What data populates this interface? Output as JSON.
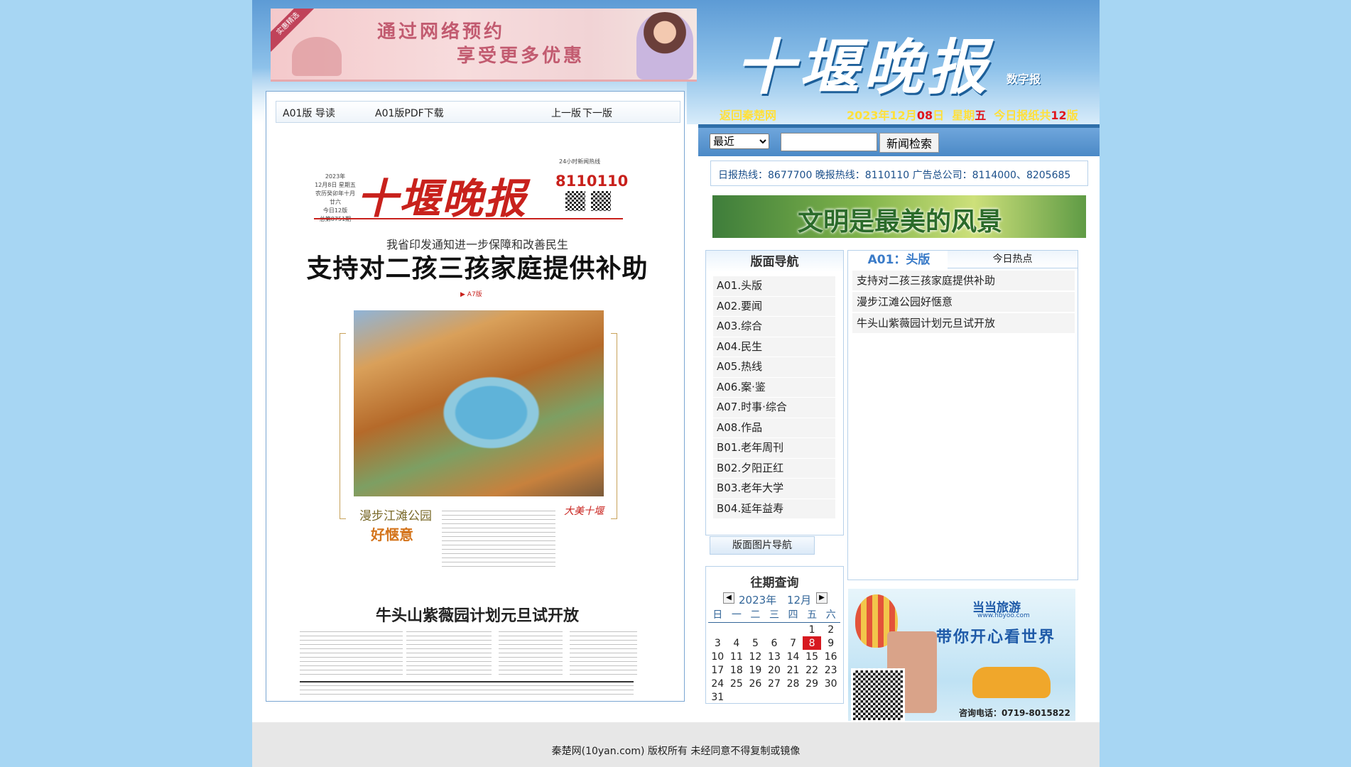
{
  "banner": {
    "ribbon": "实惠精选",
    "line1": "通过网络预约",
    "line2": "享受更多优惠"
  },
  "masthead": {
    "logo": "十堰晚报",
    "logo_sub": "数字报"
  },
  "infobar": {
    "back_link": "返回秦楚网",
    "date_prefix": "2023年12月",
    "date_day": "08",
    "date_suffix": "日",
    "weekday_prefix": "星期",
    "weekday": "五",
    "pages_prefix": "今日报纸共",
    "pages_count": "12",
    "pages_suffix": "版"
  },
  "search": {
    "select_value": "最近",
    "input_value": "",
    "button_label": "新闻检索"
  },
  "viewer": {
    "page_guide": "A01版 导读",
    "pdf_download": "A01版PDF下载",
    "prev": "上一版",
    "next": "下一版"
  },
  "paper": {
    "date_line1": "2023年",
    "date_line2": "12月8日 星期五",
    "date_line3": "农历癸卯年十月廿六",
    "date_line4": "今日12版",
    "date_line5": "总第8751期",
    "logo": "十堰晚报",
    "hotline_label": "24小时新闻热线",
    "hotline": "8110110",
    "kicker": "我省印发通知进一步保障和改善民生",
    "headline": "支持对二孩三孩家庭提供补助",
    "jump": "▶ A7版",
    "photo_title1": "漫步江滩公园",
    "photo_title2": "好惬意",
    "column_logo": "大美十堰",
    "headline2": "牛头山紫薇园计划元旦试开放"
  },
  "hotlines": {
    "text": "日报热线：8677700 晚报热线：8110110 广告总公司：8114000、8205685"
  },
  "civil_banner": {
    "text": "文明是最美的风景"
  },
  "nav": {
    "title": "版面导航",
    "items": [
      "A01.头版",
      "A02.要闻",
      "A03.综合",
      "A04.民生",
      "A05.热线",
      "A06.案·鉴",
      "A07.时事·综合",
      "A08.作品",
      "B01.老年周刊",
      "B02.夕阳正红",
      "B03.老年大学",
      "B04.延年益寿"
    ],
    "image_nav": "版面图片导航"
  },
  "hot": {
    "tab_current": "A01：头版",
    "tab_hot": "今日热点",
    "items": [
      "支持对二孩三孩家庭提供补助",
      "漫步江滩公园好惬意",
      "牛头山紫薇园计划元旦试开放"
    ]
  },
  "calendar": {
    "title": "往期查询",
    "year": "2023年",
    "month": "12月",
    "weekdays": [
      "日",
      "一",
      "二",
      "三",
      "四",
      "五",
      "六"
    ],
    "weeks": [
      [
        "",
        "",
        "",
        "",
        "",
        "1",
        "2"
      ],
      [
        "3",
        "4",
        "5",
        "6",
        "7",
        "8",
        "9"
      ],
      [
        "10",
        "11",
        "12",
        "13",
        "14",
        "15",
        "16"
      ],
      [
        "17",
        "18",
        "19",
        "20",
        "21",
        "22",
        "23"
      ],
      [
        "24",
        "25",
        "26",
        "27",
        "28",
        "29",
        "30"
      ],
      [
        "31",
        "",
        "",
        "",
        "",
        "",
        ""
      ]
    ],
    "selected": "8"
  },
  "travel_ad": {
    "brand": "当当旅游",
    "url": "www.hbyoo.com",
    "slogan": "带你开心看世界",
    "tel": "咨询电话：0719-8015822"
  },
  "footer": {
    "copyright": "秦楚网(10yan.com) 版权所有 未经同意不得复制或镜像"
  }
}
